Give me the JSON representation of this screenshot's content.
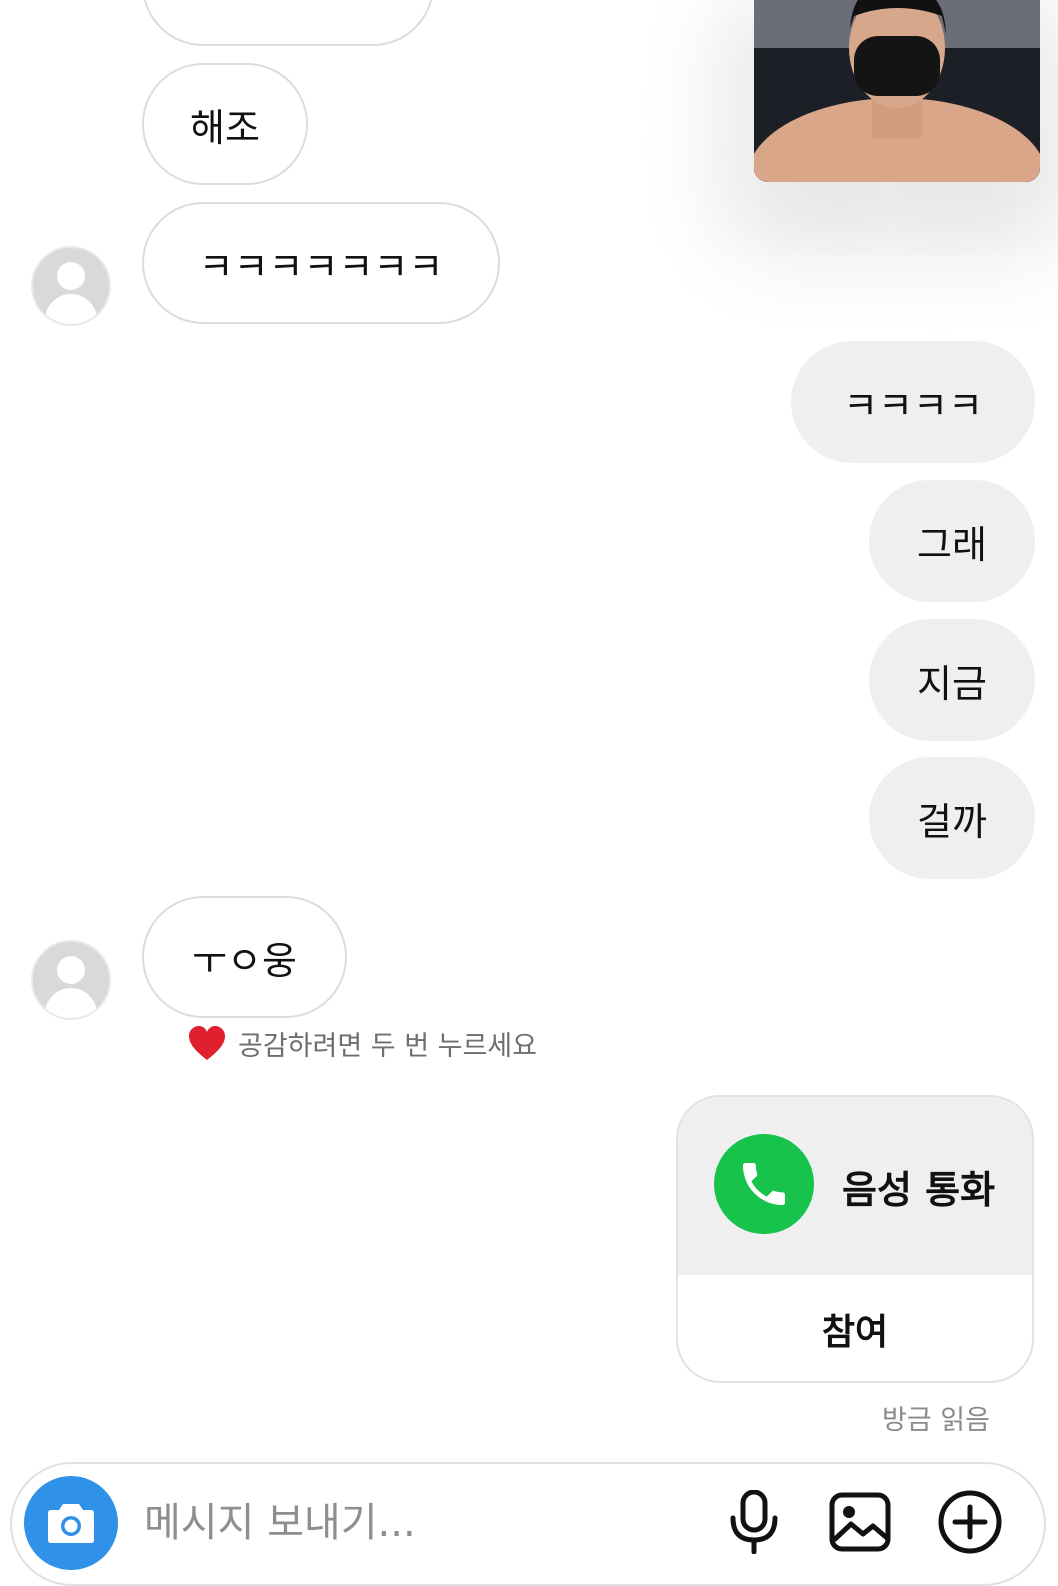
{
  "messages": {
    "incoming": [
      {
        "text": "해조"
      },
      {
        "text": "ㅋㅋㅋㅋㅋㅋㅋ"
      },
      {
        "text": "ㅜㅇ웅"
      }
    ],
    "outgoing": [
      {
        "text": "ㅋㅋㅋㅋ"
      },
      {
        "text": "그래"
      },
      {
        "text": "지금"
      },
      {
        "text": "걸까"
      }
    ]
  },
  "like_hint": {
    "emoji": "❤️",
    "text": "공감하려면 두 번 누르세요"
  },
  "call_card": {
    "title": "음성 통화",
    "join_label": "참여",
    "icon": "phone-icon",
    "accent": "#17c34a"
  },
  "read_receipt": "방금 읽음",
  "composer": {
    "placeholder": "메시지 보내기...",
    "camera_icon": "camera-icon",
    "mic_icon": "microphone-icon",
    "gallery_icon": "image-icon",
    "more_icon": "plus-circle-icon",
    "accent": "#2f92e8"
  },
  "video_preview": {
    "icon": "video-feed"
  }
}
